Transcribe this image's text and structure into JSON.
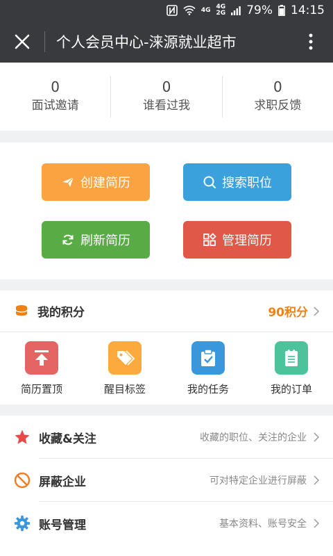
{
  "status_bar": {
    "battery": "79%",
    "time": "14:15",
    "net_top": "4G",
    "net_bottom": "2G",
    "net_left": "4G"
  },
  "title_bar": {
    "title": "个人会员中心-涞源就业超市"
  },
  "stats": [
    {
      "count": "0",
      "label": "面试邀请"
    },
    {
      "count": "0",
      "label": "谁看过我"
    },
    {
      "count": "0",
      "label": "求职反馈"
    }
  ],
  "actions": {
    "create": "创建简历",
    "search": "搜索职位",
    "refresh": "刷新简历",
    "manage": "管理简历"
  },
  "points": {
    "title": "我的积分",
    "value": "90积分",
    "items": [
      {
        "label": "简历置顶",
        "icon": "pin-top-icon",
        "color": "#e56464"
      },
      {
        "label": "醒目标签",
        "icon": "tag-icon",
        "color": "#fcaa3e"
      },
      {
        "label": "我的任务",
        "icon": "clipboard-check-icon",
        "color": "#3a97dc"
      },
      {
        "label": "我的订单",
        "icon": "order-list-icon",
        "color": "#4cc39a"
      }
    ]
  },
  "menu": [
    {
      "title": "收藏&关注",
      "desc": "收藏的职位、关注的企业",
      "icon": "star-icon"
    },
    {
      "title": "屏蔽企业",
      "desc": "可对特定企业进行屏蔽",
      "icon": "block-icon"
    },
    {
      "title": "账号管理",
      "desc": "基本资料、账号安全",
      "icon": "gear-icon"
    }
  ]
}
